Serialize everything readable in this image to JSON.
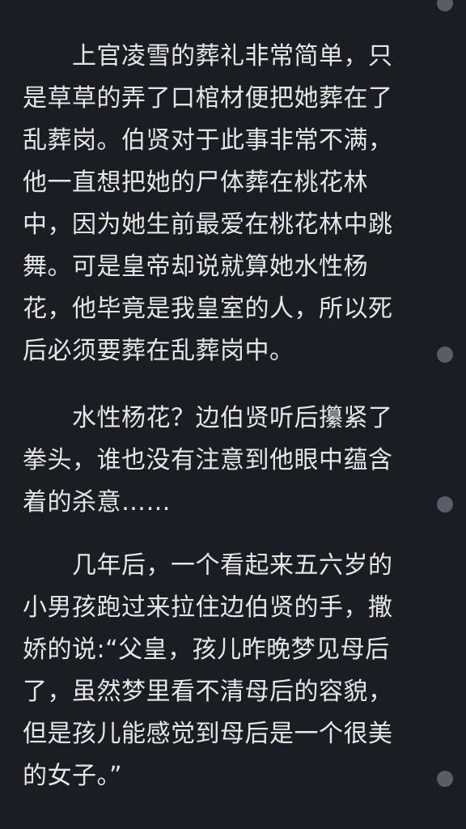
{
  "top_cut_text": "",
  "bottom_cut_text": "",
  "paragraphs": [
    {
      "lines": [
        "　　上官凌雪的葬礼非常简单，只",
        "是草草的弄了口棺材便把她葬在了",
        "乱葬岗。伯贤对于此事非常不满，",
        "他一直想把她的尸体葬在桃花林",
        "中，因为她生前最爱在桃花林中跳",
        "舞。可是皇帝却说就算她水性杨",
        "花，他毕竟是我皇室的人，所以死",
        "后必须要葬在乱葬岗中。"
      ]
    },
    {
      "lines": [
        "　　水性杨花？边伯贤听后攥紧了",
        "拳头，谁也没有注意到他眼中蕴含",
        "着的杀意……"
      ]
    },
    {
      "lines": [
        "　　几年后，一个看起来五六岁的",
        "小男孩跑过来拉住边伯贤的手，撒",
        "娇的说:“父皇，孩儿昨晚梦见母后",
        "了，虽然梦里看不清母后的容貌，",
        "但是孩儿能感觉到母后是一个很美",
        "的女子。”"
      ]
    }
  ]
}
